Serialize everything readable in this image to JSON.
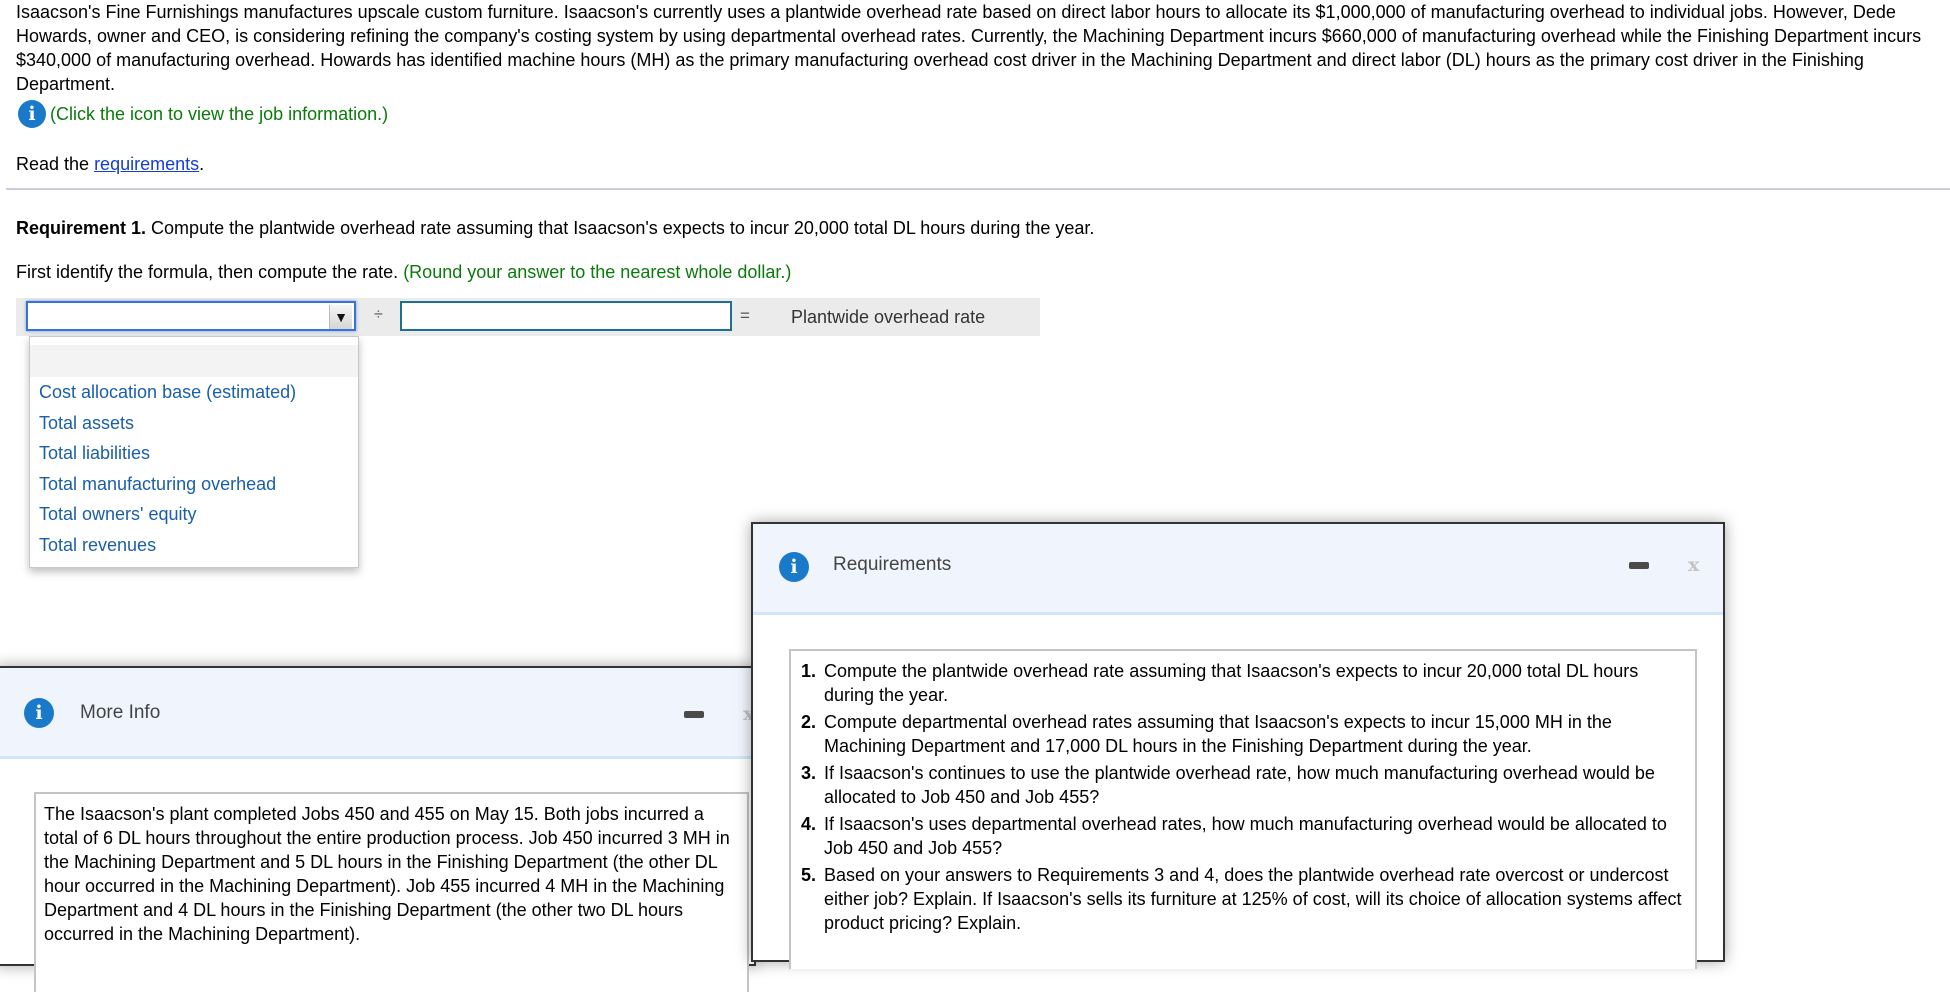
{
  "problem": {
    "text": "Isaacson's Fine Furnishings manufactures upscale custom furniture. Isaacson's currently uses a plantwide overhead rate based on direct labor hours to allocate its $1,000,000 of manufacturing overhead to individual jobs. However, Dede Howards, owner and CEO, is considering refining the company's costing system by using departmental overhead rates. Currently, the Machining Department incurs $660,000 of manufacturing overhead while the Finishing Department incurs $340,000 of manufacturing overhead. Howards has identified machine hours (MH) as the primary manufacturing overhead cost driver in the Machining Department and direct labor (DL) hours as the primary cost driver in the Finishing Department.",
    "info_hint": "(Click the icon to view the job information.)",
    "read_prefix": "Read the ",
    "read_link": "requirements",
    "read_suffix": "."
  },
  "requirement1": {
    "label": "Requirement 1.",
    "text": " Compute the plantwide overhead rate assuming that Isaacson's expects to incur 20,000 total DL hours during the year.",
    "instruction": "First identify the formula, then compute the rate. ",
    "round_hint": "(Round your answer to the nearest whole dollar.)"
  },
  "formula": {
    "select_value": "",
    "divide_symbol": "÷",
    "input_value": "",
    "equals_symbol": "=",
    "result_label": "Plantwide overhead rate",
    "dropdown_arrow": "▼",
    "options": [
      "Cost allocation base (estimated)",
      "Total assets",
      "Total liabilities",
      "Total manufacturing overhead",
      "Total owners' equity",
      "Total revenues"
    ]
  },
  "requirements_modal": {
    "title": "Requirements",
    "icon": "info-icon",
    "items": [
      {
        "num": "1.",
        "text": "Compute the plantwide overhead rate assuming that Isaacson's expects to incur 20,000 total DL hours during the year."
      },
      {
        "num": "2.",
        "text": "Compute departmental overhead rates assuming that Isaacson's expects to incur 15,000 MH in the Machining Department and 17,000 DL hours in the Finishing Department during the year."
      },
      {
        "num": "3.",
        "text": "If Isaacson's continues to use the plantwide overhead rate, how much manufacturing overhead would be allocated to Job 450 and Job 455?"
      },
      {
        "num": "4.",
        "text": "If Isaacson's uses departmental overhead rates, how much manufacturing overhead would be allocated to Job 450 and Job 455?"
      },
      {
        "num": "5.",
        "text": "Based on your answers to Requirements 3 and 4, does the plantwide overhead rate overcost or undercost either job? Explain. If Isaacson's sells its furniture at 125% of cost, will its choice of allocation systems affect product pricing? Explain."
      }
    ],
    "close_glyph": "x"
  },
  "info_modal": {
    "title": "More Info",
    "icon": "info-icon",
    "body": "The Isaacson's plant completed Jobs 450 and 455 on May 15. Both jobs incurred a total of 6 DL hours throughout the entire production process. Job 450 incurred 3 MH in the Machining Department and 5 DL hours in the Finishing Department (the other DL hour occurred in the Machining Department). Job 455 incurred 4 MH in the Machining Department and 4 DL hours in the Finishing Department (the other two DL hours occurred in the Machining Department).",
    "close_glyph": "x"
  },
  "colors": {
    "info_icon": "#1a7ac9",
    "hint_green": "#0a7a0a",
    "link_blue": "#1440d0",
    "option_blue": "#1a5fa8",
    "modal_header_bg": "#f0f5fd"
  }
}
